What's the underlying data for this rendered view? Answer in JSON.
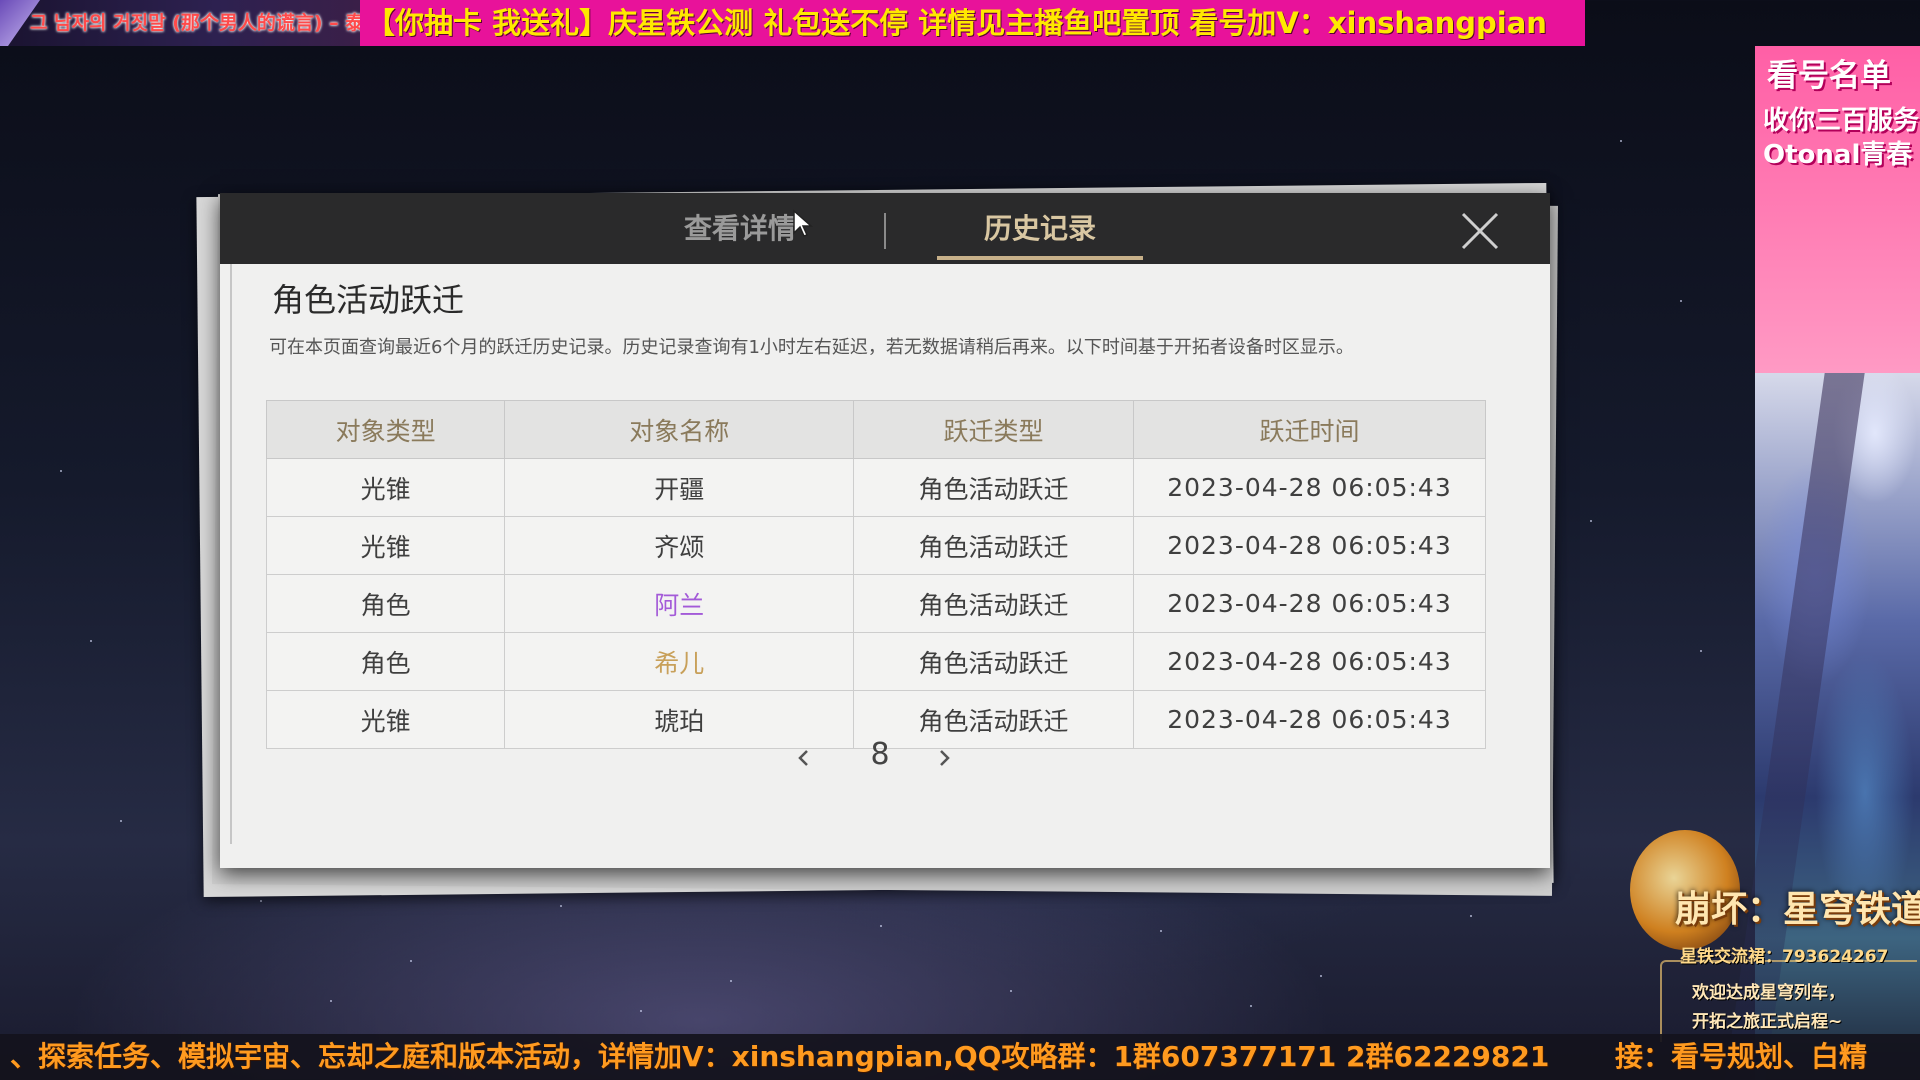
{
  "top_banner": {
    "left_text": "그 남자의 거짓말 (那个男人的谎言) – 泰",
    "promo_text": "【你抽卡 我送礼】庆星铁公测 礼包送不停   详情见主播鱼吧置顶   看号加V：xinshangpian"
  },
  "right_panel": {
    "title": "看号名单",
    "items": [
      "收你三百服务",
      "Otonal青春"
    ]
  },
  "game_logo": {
    "title": "崩坏：星穹铁道",
    "qq_group": "星铁交流裙：793624267",
    "welcome_line1": "欢迎达成星穹列车，",
    "welcome_line2": "开拓之旅正式启程~"
  },
  "bottom_ticker": {
    "left_text": "、探索任务、模拟宇宙、忘却之庭和版本活动，详情加V：xinshangpian,QQ攻略群：1群607377171 2群62229821",
    "right_text": "接：看号规划、白精"
  },
  "dialog": {
    "tabs": [
      {
        "label": "查看详情",
        "active": false
      },
      {
        "label": "历史记录",
        "active": true
      }
    ],
    "section_title": "角色活动跃迁",
    "description": "可在本页面查询最近6个月的跃迁历史记录。历史记录查询有1小时左右延迟，若无数据请稍后再来。以下时间基于开拓者设备时区显示。",
    "columns": [
      "对象类型",
      "对象名称",
      "跃迁类型",
      "跃迁时间"
    ],
    "rows": [
      {
        "type": "光锥",
        "name": "开疆",
        "name_color": "#3f3f3f",
        "warp_type": "角色活动跃迁",
        "time": "2023-04-28 06:05:43"
      },
      {
        "type": "光锥",
        "name": "齐颂",
        "name_color": "#3f3f3f",
        "warp_type": "角色活动跃迁",
        "time": "2023-04-28 06:05:43"
      },
      {
        "type": "角色",
        "name": "阿兰",
        "name_color": "#a35ad8",
        "warp_type": "角色活动跃迁",
        "time": "2023-04-28 06:05:43"
      },
      {
        "type": "角色",
        "name": "希儿",
        "name_color": "#c8a05a",
        "warp_type": "角色活动跃迁",
        "time": "2023-04-28 06:05:43"
      },
      {
        "type": "光锥",
        "name": "琥珀",
        "name_color": "#3f3f3f",
        "warp_type": "角色活动跃迁",
        "time": "2023-04-28 06:05:43"
      }
    ],
    "page": "8"
  },
  "colors": {
    "promo_bg": "#e8129a",
    "promo_text": "#ffe800",
    "ticker_text": "#ff9a1f",
    "tab_active": "#d9c7a2",
    "header_bg": "#2a2a2b"
  },
  "icons": {
    "close": "close-icon",
    "prev": "chevron-left-icon",
    "next": "chevron-right-icon",
    "cursor": "mouse-cursor-icon"
  }
}
